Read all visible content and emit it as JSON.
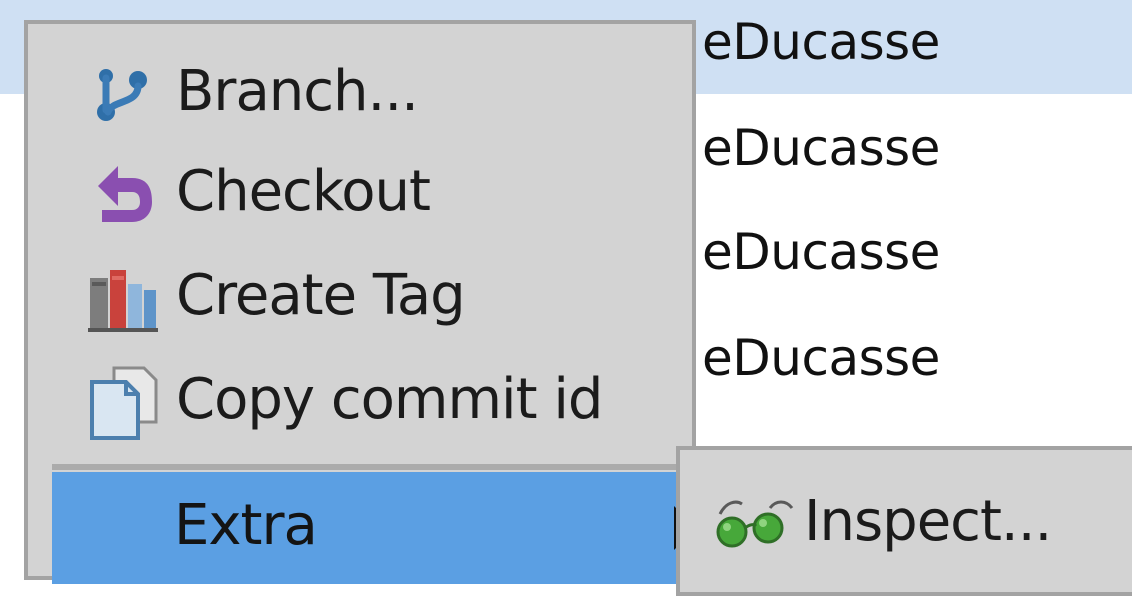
{
  "commit_list": {
    "rows": [
      {
        "author": "eDucasse",
        "selected": true
      },
      {
        "author": "eDucasse",
        "selected": false
      },
      {
        "author": "eDucasse",
        "selected": false
      },
      {
        "author": "eDucasse",
        "selected": false
      }
    ]
  },
  "context_menu": {
    "items": [
      {
        "label": "Branch...",
        "icon": "branch-icon"
      },
      {
        "label": "Checkout",
        "icon": "checkout-undo-icon"
      },
      {
        "label": "Create Tag",
        "icon": "tag-books-icon"
      },
      {
        "label": "Copy commit id",
        "icon": "copy-icon"
      }
    ],
    "extra": {
      "label": "Extra",
      "icon": "submenu-arrow-icon",
      "highlighted": true
    }
  },
  "submenu": {
    "items": [
      {
        "label": "Inspect...",
        "icon": "glasses-icon"
      }
    ]
  },
  "colors": {
    "selection_row": "#cfe0f3",
    "menu_bg": "#d3d3d3",
    "menu_border": "#a3a3a3",
    "highlight": "#5b9fe3"
  }
}
